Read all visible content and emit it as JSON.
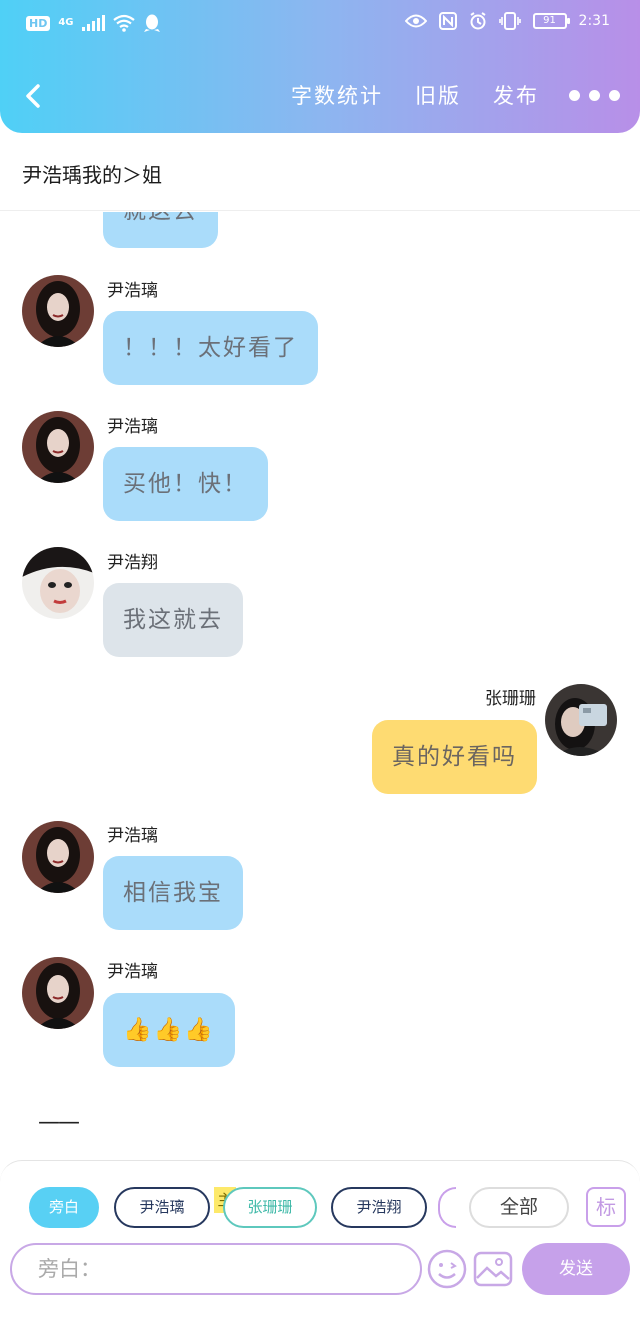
{
  "status_bar": {
    "hd": "HD",
    "network": "4G",
    "time": "2:31",
    "battery": "91"
  },
  "nav": {
    "word_count": "字数统计",
    "old_version": "旧版",
    "publish": "发布"
  },
  "title": "尹浩瑀我的＞姐",
  "messages": [
    {
      "name": "",
      "text": "就这去",
      "side": "left",
      "color": "blue",
      "partial": true
    },
    {
      "name": "尹浩璃",
      "text": "！！！太好看了",
      "side": "left",
      "color": "blue"
    },
    {
      "name": "尹浩璃",
      "text": "买他！快！",
      "side": "left",
      "color": "blue"
    },
    {
      "name": "尹浩翔",
      "text": "我这就去",
      "side": "left",
      "color": "gray"
    },
    {
      "name": "张珊珊",
      "text": "真的好看吗",
      "side": "right",
      "color": "yellow"
    },
    {
      "name": "尹浩璃",
      "text": "相信我宝",
      "side": "left",
      "color": "blue"
    },
    {
      "name": "尹浩璃",
      "text": "👍👍👍",
      "side": "left",
      "color": "blue"
    }
  ],
  "divider": "——",
  "roles": {
    "narration": "旁白",
    "role1": "尹浩璃",
    "main_tag": "主",
    "role2": "张珊珊",
    "role3": "尹浩翔",
    "all": "全部",
    "mark": "标"
  },
  "input": {
    "placeholder": "旁白："
  },
  "send": "发送"
}
